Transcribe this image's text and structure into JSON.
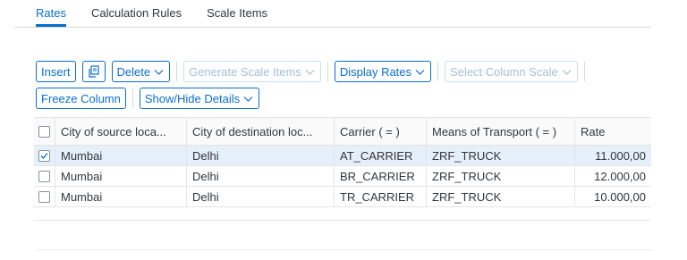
{
  "tabs": [
    {
      "label": "Rates",
      "active": true
    },
    {
      "label": "Calculation Rules",
      "active": false
    },
    {
      "label": "Scale Items",
      "active": false
    }
  ],
  "toolbar": {
    "insert_label": "Insert",
    "copy_icon": "copy-icon",
    "delete_label": "Delete",
    "generate_label": "Generate Scale Items",
    "display_rates_label": "Display Rates",
    "select_column_label": "Select Column Scale",
    "freeze_label": "Freeze Column",
    "show_hide_label": "Show/Hide Details"
  },
  "table": {
    "columns": [
      "City of source loca...",
      "City of destination loc...",
      "Carrier ( = )",
      "Means of Transport ( = )",
      "Rate"
    ],
    "rows": [
      {
        "selected": true,
        "cells": [
          "Mumbai",
          "Delhi",
          "AT_CARRIER",
          "ZRF_TRUCK",
          "11.000,00"
        ]
      },
      {
        "selected": false,
        "cells": [
          "Mumbai",
          "Delhi",
          "BR_CARRIER",
          "ZRF_TRUCK",
          "12.000,00"
        ]
      },
      {
        "selected": false,
        "cells": [
          "Mumbai",
          "Delhi",
          "TR_CARRIER",
          "ZRF_TRUCK",
          "10.000,00"
        ]
      }
    ]
  },
  "colors": {
    "accent": "#0a6ed1",
    "selected_row": "#e5f0fa"
  }
}
